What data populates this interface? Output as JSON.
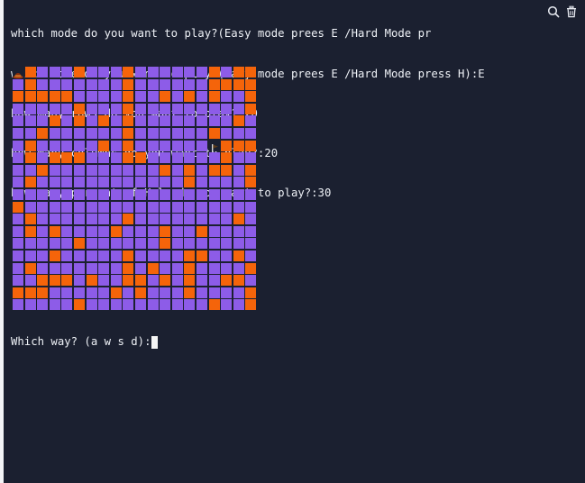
{
  "terminal": {
    "lines": [
      "which mode do you want to play?(Easy mode prees E /Hard Mode pr",
      "which mode do you want to play?(Easy mode prees E /Hard Mode press H):E",
      "how many rows do you want to play?:20",
      "how many columns do you want to play?:20",
      "how many percent of Hole do you want to play?:30"
    ],
    "prompt": "Which way? (a w s d):"
  },
  "toolbar": {
    "icons": [
      "search-icon",
      "trash-icon"
    ]
  },
  "game": {
    "rows": 20,
    "cols": 20,
    "colors": {
      "hole": "#f5640a",
      "safe": "#8d5ce8",
      "background": "#1b2030"
    },
    "player": {
      "row": 0,
      "col": 0,
      "icon": "player-hat-icon"
    },
    "target": {
      "row": 6,
      "col": 16,
      "icon": "goal-flag-icon"
    },
    "grid": [
      "POSSSOSSSOSSSSSSOSOO",
      "SOSSSSSSSOSSSSSSOOOO",
      "OOOOOSSSSOSSOSOSOSSO",
      "SSSSSOSSSOSSSSSSSSSO",
      "SSSOSOSOSOSSSSSSSSOS",
      "SSOSSSSSSOSSSSSSOSSS",
      "SOSSSSSOSOSSSSSSTOOO",
      "SOSOOOSSSOOSSSSSSOSS",
      "SSOSSSSSSSSSOSOSOOSO",
      "SOSSSSSSSSSSSSOSSSSO",
      "SSSSSSSSSSSSSSSSSSSS",
      "OSSSSSSSSSSSSSSSSSSS",
      "SOSSSSSSSOSSSSSSSSOS",
      "SOSOSSSSOSSSOSSOSSSS",
      "SSSSSOSSSSSSOSSSSSSS",
      "SSSOSSSSSOSSSSOOSSOS",
      "SOSSSSSSSOSOSSOSSSSO",
      "SSOOOSOSSOOSOSOSSOOS",
      "OOOSSSSSOSOSSSOSSSSO",
      "SSSSSOSSSSSSSSSSOSSO"
    ]
  }
}
